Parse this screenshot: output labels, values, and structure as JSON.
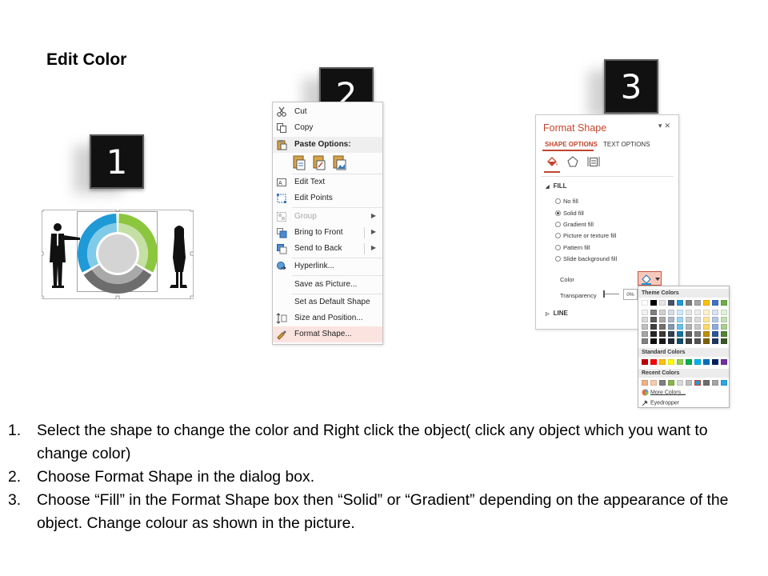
{
  "title": "Edit Color",
  "badges": [
    "1",
    "2",
    "3"
  ],
  "context_menu": {
    "items": [
      {
        "label": "Cut",
        "icon": "scissors-icon"
      },
      {
        "label": "Copy",
        "icon": "copy-icon"
      },
      {
        "label": "Paste Options:",
        "icon": "paste-icon"
      },
      {
        "label": "Edit Text",
        "icon": "edit-text-icon"
      },
      {
        "label": "Edit Points",
        "icon": "edit-points-icon"
      },
      {
        "label": "Group",
        "icon": "group-icon"
      },
      {
        "label": "Bring to Front",
        "icon": "bring-front-icon"
      },
      {
        "label": "Send to Back",
        "icon": "send-back-icon"
      },
      {
        "label": "Hyperlink...",
        "icon": "hyperlink-icon"
      },
      {
        "label": "Save as Picture...",
        "icon": ""
      },
      {
        "label": "Set as Default Shape",
        "icon": ""
      },
      {
        "label": "Size and Position...",
        "icon": "size-position-icon"
      },
      {
        "label": "Format Shape...",
        "icon": "format-shape-icon"
      }
    ]
  },
  "format_pane": {
    "title": "Format Shape",
    "tabs": [
      "SHAPE OPTIONS",
      "TEXT OPTIONS"
    ],
    "fill_header": "FILL",
    "fill_options": [
      "No fill",
      "Solid fill",
      "Gradient fill",
      "Picture or texture fill",
      "Pattern fill",
      "Slide background fill"
    ],
    "selected_fill": "Solid fill",
    "color_label": "Color",
    "transparency_label": "Transparency",
    "transparency_value": "0%",
    "line_header": "LINE"
  },
  "palette": {
    "theme_header": "Theme Colors",
    "standard_header": "Standard Colors",
    "recent_header": "Recent Colors",
    "more_colors": "More Colors...",
    "eyedropper": "Eyedropper",
    "theme_top": [
      "#ffffff",
      "#000000",
      "#e7e6e6",
      "#44546a",
      "#1f9ad6",
      "#808080",
      "#a5a5a5",
      "#ffc000",
      "#4472c4",
      "#70ad47"
    ],
    "theme_columns": [
      [
        "#f2f2f2",
        "#d9d9d9",
        "#bfbfbf",
        "#a6a6a6",
        "#808080"
      ],
      [
        "#808080",
        "#595959",
        "#404040",
        "#262626",
        "#0d0d0d"
      ],
      [
        "#d0cece",
        "#aeaaaa",
        "#757171",
        "#3a3838",
        "#171616"
      ],
      [
        "#d6dce5",
        "#adb9ca",
        "#8497b0",
        "#323f4f",
        "#222a35"
      ],
      [
        "#cdeaf8",
        "#9bd5f1",
        "#69c0ea",
        "#1673a0",
        "#0f4d6b"
      ],
      [
        "#e6e6e6",
        "#cccccc",
        "#b3b3b3",
        "#606060",
        "#404040"
      ],
      [
        "#ededed",
        "#dbdbdb",
        "#c9c9c9",
        "#7c7c7c",
        "#525252"
      ],
      [
        "#fff2cc",
        "#ffe699",
        "#ffd966",
        "#bf9000",
        "#7f6000"
      ],
      [
        "#dae3f3",
        "#b4c7e7",
        "#8faadc",
        "#2f5597",
        "#1f3864"
      ],
      [
        "#e2f0d9",
        "#c5e0b4",
        "#a9d18e",
        "#548235",
        "#385723"
      ]
    ],
    "standard": [
      "#c00000",
      "#ff0000",
      "#ffc000",
      "#ffff00",
      "#92d050",
      "#00b050",
      "#00b0f0",
      "#0070c0",
      "#002060",
      "#7030a0"
    ],
    "recent": [
      "#f4b183",
      "#f8cbad",
      "#7f7f7f",
      "#8ab34a",
      "#d9d9d9",
      "#bfbfbf",
      "#1f9ad6",
      "#6e6e6e",
      "#a6a6a6",
      "#2ea7e0"
    ]
  },
  "diagram": {
    "colors": {
      "green": "#8cc63f",
      "light_green": "#c5e0a5",
      "blue": "#1f9ad6",
      "light_blue": "#7fcbe8",
      "gray": "#6d6d6d",
      "light_gray": "#a9a9a9",
      "center": "#d4d4d4"
    }
  },
  "instructions": [
    {
      "num": "1.",
      "text": "Select the shape to change the color and Right click the object( click any object which you want to change color)"
    },
    {
      "num": "2.",
      "text": "Choose Format Shape in the dialog box."
    },
    {
      "num": "3.",
      "text": "Choose “Fill” in the Format Shape box then “Solid” or “Gradient” depending on the appearance of the object. Change colour as shown in the picture."
    }
  ]
}
